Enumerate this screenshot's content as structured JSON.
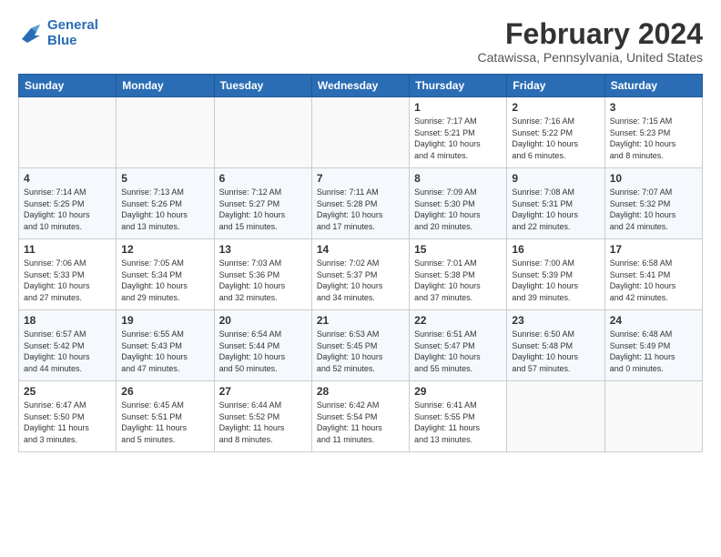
{
  "logo": {
    "line1": "General",
    "line2": "Blue"
  },
  "title": "February 2024",
  "location": "Catawissa, Pennsylvania, United States",
  "days_of_week": [
    "Sunday",
    "Monday",
    "Tuesday",
    "Wednesday",
    "Thursday",
    "Friday",
    "Saturday"
  ],
  "weeks": [
    [
      {
        "day": "",
        "info": ""
      },
      {
        "day": "",
        "info": ""
      },
      {
        "day": "",
        "info": ""
      },
      {
        "day": "",
        "info": ""
      },
      {
        "day": "1",
        "info": "Sunrise: 7:17 AM\nSunset: 5:21 PM\nDaylight: 10 hours\nand 4 minutes."
      },
      {
        "day": "2",
        "info": "Sunrise: 7:16 AM\nSunset: 5:22 PM\nDaylight: 10 hours\nand 6 minutes."
      },
      {
        "day": "3",
        "info": "Sunrise: 7:15 AM\nSunset: 5:23 PM\nDaylight: 10 hours\nand 8 minutes."
      }
    ],
    [
      {
        "day": "4",
        "info": "Sunrise: 7:14 AM\nSunset: 5:25 PM\nDaylight: 10 hours\nand 10 minutes."
      },
      {
        "day": "5",
        "info": "Sunrise: 7:13 AM\nSunset: 5:26 PM\nDaylight: 10 hours\nand 13 minutes."
      },
      {
        "day": "6",
        "info": "Sunrise: 7:12 AM\nSunset: 5:27 PM\nDaylight: 10 hours\nand 15 minutes."
      },
      {
        "day": "7",
        "info": "Sunrise: 7:11 AM\nSunset: 5:28 PM\nDaylight: 10 hours\nand 17 minutes."
      },
      {
        "day": "8",
        "info": "Sunrise: 7:09 AM\nSunset: 5:30 PM\nDaylight: 10 hours\nand 20 minutes."
      },
      {
        "day": "9",
        "info": "Sunrise: 7:08 AM\nSunset: 5:31 PM\nDaylight: 10 hours\nand 22 minutes."
      },
      {
        "day": "10",
        "info": "Sunrise: 7:07 AM\nSunset: 5:32 PM\nDaylight: 10 hours\nand 24 minutes."
      }
    ],
    [
      {
        "day": "11",
        "info": "Sunrise: 7:06 AM\nSunset: 5:33 PM\nDaylight: 10 hours\nand 27 minutes."
      },
      {
        "day": "12",
        "info": "Sunrise: 7:05 AM\nSunset: 5:34 PM\nDaylight: 10 hours\nand 29 minutes."
      },
      {
        "day": "13",
        "info": "Sunrise: 7:03 AM\nSunset: 5:36 PM\nDaylight: 10 hours\nand 32 minutes."
      },
      {
        "day": "14",
        "info": "Sunrise: 7:02 AM\nSunset: 5:37 PM\nDaylight: 10 hours\nand 34 minutes."
      },
      {
        "day": "15",
        "info": "Sunrise: 7:01 AM\nSunset: 5:38 PM\nDaylight: 10 hours\nand 37 minutes."
      },
      {
        "day": "16",
        "info": "Sunrise: 7:00 AM\nSunset: 5:39 PM\nDaylight: 10 hours\nand 39 minutes."
      },
      {
        "day": "17",
        "info": "Sunrise: 6:58 AM\nSunset: 5:41 PM\nDaylight: 10 hours\nand 42 minutes."
      }
    ],
    [
      {
        "day": "18",
        "info": "Sunrise: 6:57 AM\nSunset: 5:42 PM\nDaylight: 10 hours\nand 44 minutes."
      },
      {
        "day": "19",
        "info": "Sunrise: 6:55 AM\nSunset: 5:43 PM\nDaylight: 10 hours\nand 47 minutes."
      },
      {
        "day": "20",
        "info": "Sunrise: 6:54 AM\nSunset: 5:44 PM\nDaylight: 10 hours\nand 50 minutes."
      },
      {
        "day": "21",
        "info": "Sunrise: 6:53 AM\nSunset: 5:45 PM\nDaylight: 10 hours\nand 52 minutes."
      },
      {
        "day": "22",
        "info": "Sunrise: 6:51 AM\nSunset: 5:47 PM\nDaylight: 10 hours\nand 55 minutes."
      },
      {
        "day": "23",
        "info": "Sunrise: 6:50 AM\nSunset: 5:48 PM\nDaylight: 10 hours\nand 57 minutes."
      },
      {
        "day": "24",
        "info": "Sunrise: 6:48 AM\nSunset: 5:49 PM\nDaylight: 11 hours\nand 0 minutes."
      }
    ],
    [
      {
        "day": "25",
        "info": "Sunrise: 6:47 AM\nSunset: 5:50 PM\nDaylight: 11 hours\nand 3 minutes."
      },
      {
        "day": "26",
        "info": "Sunrise: 6:45 AM\nSunset: 5:51 PM\nDaylight: 11 hours\nand 5 minutes."
      },
      {
        "day": "27",
        "info": "Sunrise: 6:44 AM\nSunset: 5:52 PM\nDaylight: 11 hours\nand 8 minutes."
      },
      {
        "day": "28",
        "info": "Sunrise: 6:42 AM\nSunset: 5:54 PM\nDaylight: 11 hours\nand 11 minutes."
      },
      {
        "day": "29",
        "info": "Sunrise: 6:41 AM\nSunset: 5:55 PM\nDaylight: 11 hours\nand 13 minutes."
      },
      {
        "day": "",
        "info": ""
      },
      {
        "day": "",
        "info": ""
      }
    ]
  ]
}
